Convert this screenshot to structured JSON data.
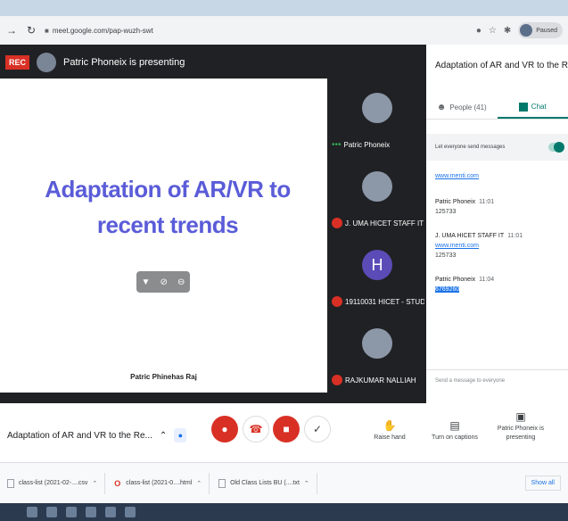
{
  "browser": {
    "url": "meet.google.com/pap-wuzh-swt",
    "profile_label": "Paused"
  },
  "meet": {
    "rec_label": "REC",
    "presenting_text": "Patric Phoneix is presenting",
    "slide": {
      "title": "Adaptation of AR/VR to recent trends",
      "author": "Patric Phinehas Raj"
    },
    "participants": [
      {
        "name": "Patric Phoneix",
        "initial": "",
        "muted": false
      },
      {
        "name": "J. UMA HICET STAFF IT",
        "initial": "",
        "muted": true
      },
      {
        "name": "19110031 HICET - STUDE...",
        "initial": "H",
        "muted": true
      },
      {
        "name": "RAJKUMAR NALLIAH",
        "initial": "",
        "muted": true
      }
    ]
  },
  "panel": {
    "title": "Adaptation of AR and VR to the R...",
    "tabs": {
      "people": "People (41)",
      "chat": "Chat"
    },
    "toggle_label": "Let everyone send messages",
    "messages": [
      {
        "sender": "",
        "time": "",
        "link": "www.menti.com",
        "text": ""
      },
      {
        "sender": "Patric Phoneix",
        "time": "11:01",
        "link": "",
        "text": "125733"
      },
      {
        "sender": "J. UMA HICET STAFF IT",
        "time": "11:01",
        "link": "www.menti.com",
        "text": "125733"
      },
      {
        "sender": "Patric Phoneix",
        "time": "11:04",
        "link": "",
        "text": "6769260"
      }
    ],
    "send_placeholder": "Send a message to everyone"
  },
  "controls": {
    "meeting_title": "Adaptation of AR and VR to the Re...",
    "raise_hand": "Raise hand",
    "captions": "Turn on captions",
    "presenting": "Patric Phoneix is presenting"
  },
  "downloads": {
    "items": [
      "class-list (2021-02-....csv",
      "class-list (2021-0....html",
      "Old Class Lists BU (....txt"
    ],
    "show_all": "Show all"
  }
}
